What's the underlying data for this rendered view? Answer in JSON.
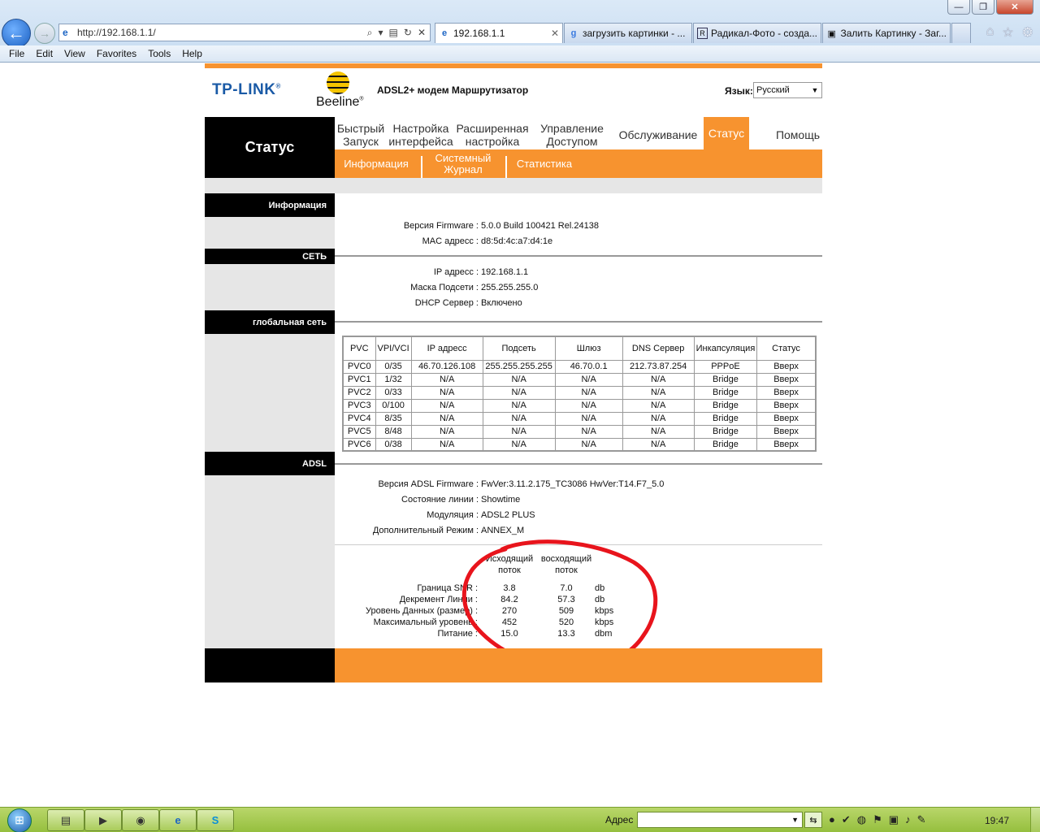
{
  "browser": {
    "address": "http://192.168.1.1/",
    "tabs": [
      {
        "title": "192.168.1.1",
        "active": true,
        "icon": "ie-page-icon"
      },
      {
        "title": "загрузить картинки - ...",
        "active": false,
        "icon": "google-icon"
      },
      {
        "title": "Радикал-Фото - созда...",
        "active": false,
        "icon": "radikal-icon"
      },
      {
        "title": "Залить Картинку - Заг...",
        "active": false,
        "icon": "image-icon"
      }
    ],
    "menu": [
      "File",
      "Edit",
      "View",
      "Favorites",
      "Tools",
      "Help"
    ]
  },
  "router": {
    "logo_tp": "TP-LINK",
    "logo_beeline": "Beeline",
    "model_title": "ADSL2+ модем Маршрутизатор",
    "lang_label": "Язык:",
    "lang_value": "Русский",
    "section_title": "Статус",
    "main_nav": [
      {
        "label": "Быстрый Запуск",
        "active": false
      },
      {
        "label": "Настройка интерфейса",
        "active": false
      },
      {
        "label": "Расширенная настройка",
        "active": false
      },
      {
        "label": "Управление Доступом",
        "active": false
      },
      {
        "label": "Обслуживание",
        "active": false
      },
      {
        "label": "Статус",
        "active": true
      },
      {
        "label": "Помощь",
        "active": false
      }
    ],
    "sub_nav": [
      "Информация",
      "Системный Журнал",
      "Статистика"
    ]
  },
  "info": {
    "label": "Информация",
    "firmware_key": "Версия Firmware :",
    "firmware_val": "5.0.0 Build 100421 Rel.24138",
    "mac_key": "MAC адресс :",
    "mac_val": "d8:5d:4c:a7:d4:1e"
  },
  "lan": {
    "label": "СЕТЬ",
    "ip_key": "IP адресс :",
    "ip_val": "192.168.1.1",
    "mask_key": "Маска Подсети :",
    "mask_val": "255.255.255.0",
    "dhcp_key": "DHCP Сервер :",
    "dhcp_val": "Включено"
  },
  "wan": {
    "label": "глобальная сеть",
    "headers": [
      "PVC",
      "VPI/VCI",
      "IP адресс",
      "Подсеть",
      "Шлюз",
      "DNS Сервер",
      "Инкапсуляция",
      "Статус"
    ],
    "rows": [
      [
        "PVC0",
        "0/35",
        "46.70.126.108",
        "255.255.255.255",
        "46.70.0.1",
        "212.73.87.254",
        "PPPoE",
        "Вверх"
      ],
      [
        "PVC1",
        "1/32",
        "N/A",
        "N/A",
        "N/A",
        "N/A",
        "Bridge",
        "Вверх"
      ],
      [
        "PVC2",
        "0/33",
        "N/A",
        "N/A",
        "N/A",
        "N/A",
        "Bridge",
        "Вверх"
      ],
      [
        "PVC3",
        "0/100",
        "N/A",
        "N/A",
        "N/A",
        "N/A",
        "Bridge",
        "Вверх"
      ],
      [
        "PVC4",
        "8/35",
        "N/A",
        "N/A",
        "N/A",
        "N/A",
        "Bridge",
        "Вверх"
      ],
      [
        "PVC5",
        "8/48",
        "N/A",
        "N/A",
        "N/A",
        "N/A",
        "Bridge",
        "Вверх"
      ],
      [
        "PVC6",
        "0/38",
        "N/A",
        "N/A",
        "N/A",
        "N/A",
        "Bridge",
        "Вверх"
      ]
    ]
  },
  "adsl": {
    "label": "ADSL",
    "fw_key": "Версия ADSL Firmware :",
    "fw_val": "FwVer:3.11.2.175_TC3086 HwVer:T14.F7_5.0",
    "line_key": "Состояние линии :",
    "line_val": "Showtime",
    "mod_key": "Модуляция :",
    "mod_val": "ADSL2 PLUS",
    "annex_key": "Дополнительный Режим :",
    "annex_val": "ANNEX_M",
    "col_down_1": "Исходящий",
    "col_down_2": "поток",
    "col_up_1": "восходящий",
    "col_up_2": "поток",
    "stats": [
      {
        "key": "Граница SNR :",
        "down": "3.8",
        "up": "7.0",
        "unit": "db"
      },
      {
        "key": "Декремент Линии :",
        "down": "84.2",
        "up": "57.3",
        "unit": "db"
      },
      {
        "key": "Уровень Данных (размер) :",
        "down": "270",
        "up": "509",
        "unit": "kbps"
      },
      {
        "key": "Максимальный уровень :",
        "down": "452",
        "up": "520",
        "unit": "kbps"
      },
      {
        "key": "Питание :",
        "down": "15.0",
        "up": "13.3",
        "unit": "dbm"
      }
    ]
  },
  "taskbar": {
    "addr_label": "Адрес",
    "clock": "19:47"
  },
  "colors": {
    "orange": "#f7932f",
    "annotation_red": "#e8141c"
  }
}
